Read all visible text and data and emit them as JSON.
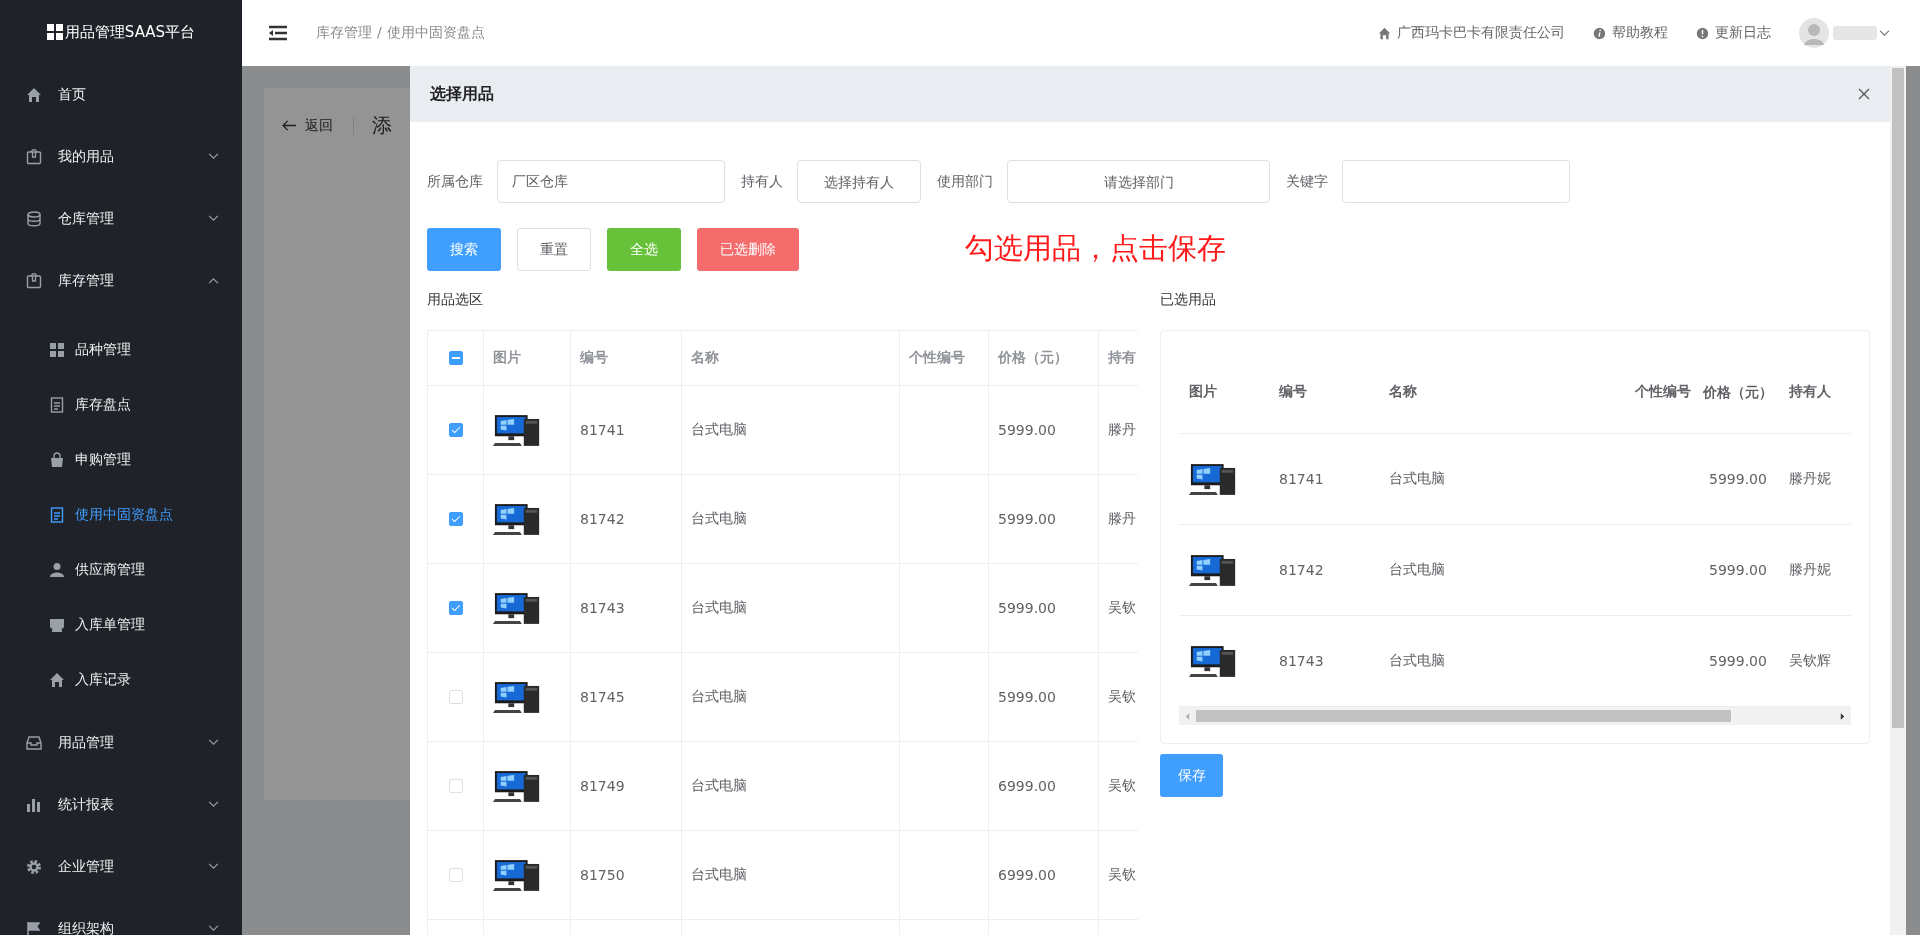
{
  "sidebar": {
    "logo": "用品管理SAAS平台",
    "items": [
      {
        "label": "首页",
        "kind": "link"
      },
      {
        "label": "我的用品",
        "kind": "group",
        "expanded": false
      },
      {
        "label": "仓库管理",
        "kind": "group",
        "expanded": false
      },
      {
        "label": "库存管理",
        "kind": "group",
        "expanded": true,
        "children": [
          {
            "label": "品种管理",
            "selected": false
          },
          {
            "label": "库存盘点",
            "selected": false
          },
          {
            "label": "申购管理",
            "selected": false
          },
          {
            "label": "使用中固资盘点",
            "selected": true
          },
          {
            "label": "供应商管理",
            "selected": false
          },
          {
            "label": "入库单管理",
            "selected": false
          },
          {
            "label": "入库记录",
            "selected": false
          }
        ]
      },
      {
        "label": "用品管理",
        "kind": "group",
        "expanded": false
      },
      {
        "label": "统计报表",
        "kind": "group",
        "expanded": false
      },
      {
        "label": "企业管理",
        "kind": "group",
        "expanded": false
      },
      {
        "label": "组织架构",
        "kind": "group",
        "expanded": false
      }
    ]
  },
  "header": {
    "breadcrumb": [
      "库存管理",
      "使用中固资盘点"
    ],
    "separator": "/",
    "links": [
      "广西玛卡巴卡有限责任公司",
      "帮助教程",
      "更新日志"
    ]
  },
  "page": {
    "back": "返回",
    "title": "添"
  },
  "dialog": {
    "title": "选择用品",
    "filters": [
      {
        "label": "所属仓库",
        "value": "厂区仓库"
      },
      {
        "label": "持有人",
        "placeholder": "选择持有人"
      },
      {
        "label": "使用部门",
        "placeholder": "请选择部门"
      },
      {
        "label": "关键字"
      }
    ],
    "buttons": [
      {
        "label": "搜索",
        "kind": "primary"
      },
      {
        "label": "重置",
        "kind": "default"
      },
      {
        "label": "全选",
        "kind": "success"
      },
      {
        "label": "已选删除",
        "kind": "danger"
      }
    ],
    "annotation": "勾选用品，点击保存",
    "left": {
      "title": "用品选区",
      "select_all_indeterminate": true,
      "columns": [
        "图片",
        "编号",
        "名称",
        "个性编号",
        "价格（元）",
        "持有"
      ],
      "rows": [
        {
          "selected": true,
          "code": "81741",
          "name": "台式电脑",
          "price": "5999.00",
          "holder": "滕丹"
        },
        {
          "selected": true,
          "code": "81742",
          "name": "台式电脑",
          "price": "5999.00",
          "holder": "滕丹"
        },
        {
          "selected": true,
          "code": "81743",
          "name": "台式电脑",
          "price": "5999.00",
          "holder": "吴钦"
        },
        {
          "selected": false,
          "code": "81745",
          "name": "台式电脑",
          "price": "5999.00",
          "holder": "吴钦"
        },
        {
          "selected": false,
          "code": "81749",
          "name": "台式电脑",
          "price": "6999.00",
          "holder": "吴钦"
        },
        {
          "selected": false,
          "code": "81750",
          "name": "台式电脑",
          "price": "6999.00",
          "holder": "吴钦"
        }
      ]
    },
    "right": {
      "title": "已选用品",
      "columns": [
        "图片",
        "编号",
        "名称",
        "个性编号",
        "价格（元）",
        "持有人"
      ],
      "rows": [
        {
          "code": "81741",
          "name": "台式电脑",
          "price": "5999.00",
          "holder": "滕丹妮"
        },
        {
          "code": "81742",
          "name": "台式电脑",
          "price": "5999.00",
          "holder": "滕丹妮"
        },
        {
          "code": "81743",
          "name": "台式电脑",
          "price": "5999.00",
          "holder": "吴钦辉"
        }
      ]
    },
    "save": "保存"
  }
}
